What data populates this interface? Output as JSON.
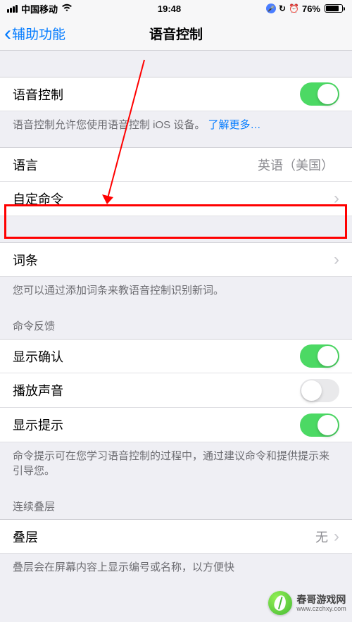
{
  "status": {
    "carrier": "中国移动",
    "time": "19:48",
    "battery_pct": "76%"
  },
  "nav": {
    "back": "辅助功能",
    "title": "语音控制"
  },
  "voice_control": {
    "label": "语音控制",
    "on": true,
    "desc_text": "语音控制允许您使用语音控制 iOS 设备。",
    "learn_more": "了解更多…"
  },
  "language": {
    "label": "语言",
    "value": "英语（美国）"
  },
  "custom_cmd": {
    "label": "自定命令"
  },
  "vocab": {
    "label": "词条",
    "desc": "您可以通过添加词条来教语音控制识别新词。"
  },
  "feedback": {
    "header": "命令反馈",
    "show_confirm": {
      "label": "显示确认",
      "on": true
    },
    "play_sound": {
      "label": "播放声音",
      "on": false
    },
    "show_hints": {
      "label": "显示提示",
      "on": true
    },
    "desc": "命令提示可在您学习语音控制的过程中，通过建议命令和提供提示来引导您。"
  },
  "overlay": {
    "header": "连续叠层",
    "label": "叠层",
    "value": "无",
    "desc": "叠层会在屏幕内容上显示编号或名称，以方便快"
  },
  "watermark": {
    "name": "春哥游戏网",
    "url": "www.czchxy.com"
  }
}
